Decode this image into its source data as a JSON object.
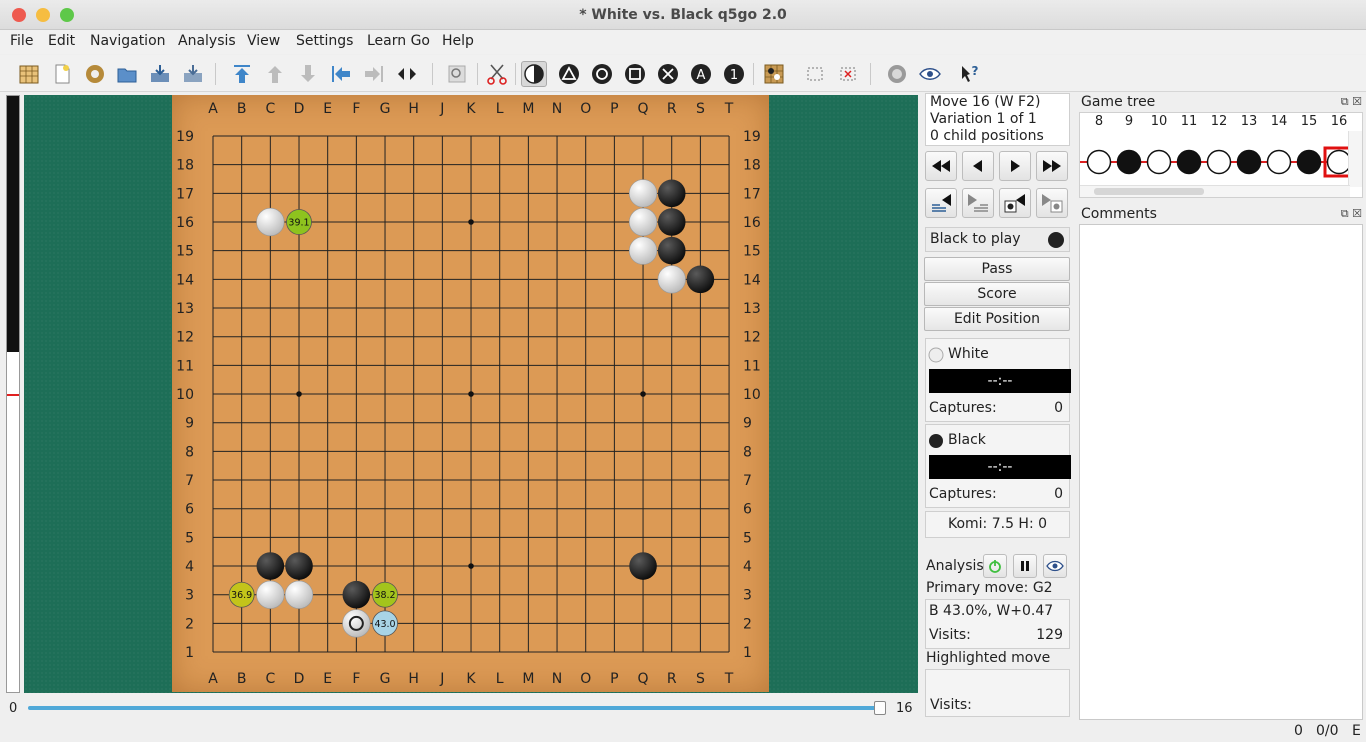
{
  "window": {
    "title": "* White vs. Black   q5go 2.0"
  },
  "menu": [
    "File",
    "Edit",
    "Navigation",
    "Analysis",
    "View",
    "Settings",
    "Learn Go",
    "Help"
  ],
  "board": {
    "col_labels": [
      "A",
      "B",
      "C",
      "D",
      "E",
      "F",
      "G",
      "H",
      "J",
      "K",
      "L",
      "M",
      "N",
      "O",
      "P",
      "Q",
      "R",
      "S",
      "T"
    ],
    "row_labels": [
      "19",
      "18",
      "17",
      "16",
      "15",
      "14",
      "13",
      "12",
      "11",
      "10",
      "9",
      "8",
      "7",
      "6",
      "5",
      "4",
      "3",
      "2",
      "1"
    ],
    "black_stones": [
      "R17",
      "R16",
      "R15",
      "S14",
      "C4",
      "D4",
      "F3",
      "Q4"
    ],
    "white_stones": [
      "Q17",
      "Q16",
      "Q15",
      "R14",
      "C16",
      "C3",
      "D3",
      "F2"
    ],
    "last_move": "F2",
    "hints": [
      {
        "point": "D16",
        "label": "39.1",
        "color": "#8ec31e"
      },
      {
        "point": "B3",
        "label": "36.9",
        "color": "#c3c41a"
      },
      {
        "point": "G3",
        "label": "38.2",
        "color": "#a3c41c"
      },
      {
        "point": "G2",
        "label": "43.0",
        "color": "#a8d4e6"
      }
    ]
  },
  "slider": {
    "min": "0",
    "max": "16",
    "value": 16
  },
  "info": {
    "move": "Move 16 (W F2)",
    "variation": "Variation 1 of 1",
    "children": "0 child positions"
  },
  "turn": {
    "text": "Black to play"
  },
  "buttons": {
    "pass": "Pass",
    "score": "Score",
    "edit": "Edit Position"
  },
  "white": {
    "name": "White",
    "clock": "--:--",
    "captures_label": "Captures:",
    "captures": "0"
  },
  "black": {
    "name": "Black",
    "clock": "--:--",
    "captures_label": "Captures:",
    "captures": "0"
  },
  "komi": {
    "text": "Komi:  7.5  H:  0"
  },
  "analysis": {
    "label": "Analysis",
    "primary": "Primary move: G2",
    "winrate": "B 43.0%, W+0.47",
    "visits_label": "Visits:",
    "visits": "129",
    "highlighted": "Highlighted move",
    "hl_visits_label": "Visits:"
  },
  "game_tree": {
    "title": "Game tree",
    "numbers": [
      "8",
      "9",
      "10",
      "11",
      "12",
      "13",
      "14",
      "15",
      "16"
    ],
    "nodes": [
      "white",
      "black",
      "white",
      "black",
      "white",
      "black",
      "white",
      "black",
      "white"
    ]
  },
  "comments": {
    "title": "Comments"
  },
  "status": {
    "a": "0",
    "b": "0/0",
    "c": "E"
  },
  "colors": {
    "felt": "#1d6e57",
    "board": "#dc9a55",
    "slider": "#4fa8d8",
    "accent": "#e02020"
  }
}
